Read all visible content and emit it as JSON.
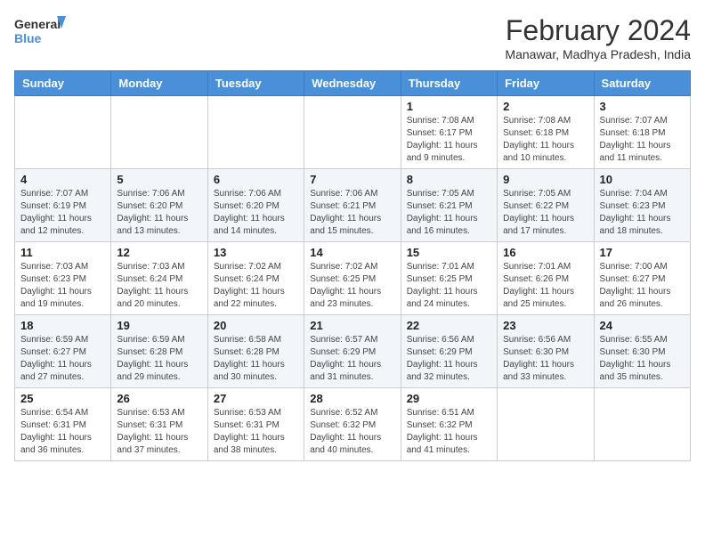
{
  "header": {
    "logo_general": "General",
    "logo_blue": "Blue",
    "month_title": "February 2024",
    "subtitle": "Manawar, Madhya Pradesh, India"
  },
  "weekdays": [
    "Sunday",
    "Monday",
    "Tuesday",
    "Wednesday",
    "Thursday",
    "Friday",
    "Saturday"
  ],
  "weeks": [
    [
      {
        "day": "",
        "info": ""
      },
      {
        "day": "",
        "info": ""
      },
      {
        "day": "",
        "info": ""
      },
      {
        "day": "",
        "info": ""
      },
      {
        "day": "1",
        "info": "Sunrise: 7:08 AM\nSunset: 6:17 PM\nDaylight: 11 hours and 9 minutes."
      },
      {
        "day": "2",
        "info": "Sunrise: 7:08 AM\nSunset: 6:18 PM\nDaylight: 11 hours and 10 minutes."
      },
      {
        "day": "3",
        "info": "Sunrise: 7:07 AM\nSunset: 6:18 PM\nDaylight: 11 hours and 11 minutes."
      }
    ],
    [
      {
        "day": "4",
        "info": "Sunrise: 7:07 AM\nSunset: 6:19 PM\nDaylight: 11 hours and 12 minutes."
      },
      {
        "day": "5",
        "info": "Sunrise: 7:06 AM\nSunset: 6:20 PM\nDaylight: 11 hours and 13 minutes."
      },
      {
        "day": "6",
        "info": "Sunrise: 7:06 AM\nSunset: 6:20 PM\nDaylight: 11 hours and 14 minutes."
      },
      {
        "day": "7",
        "info": "Sunrise: 7:06 AM\nSunset: 6:21 PM\nDaylight: 11 hours and 15 minutes."
      },
      {
        "day": "8",
        "info": "Sunrise: 7:05 AM\nSunset: 6:21 PM\nDaylight: 11 hours and 16 minutes."
      },
      {
        "day": "9",
        "info": "Sunrise: 7:05 AM\nSunset: 6:22 PM\nDaylight: 11 hours and 17 minutes."
      },
      {
        "day": "10",
        "info": "Sunrise: 7:04 AM\nSunset: 6:23 PM\nDaylight: 11 hours and 18 minutes."
      }
    ],
    [
      {
        "day": "11",
        "info": "Sunrise: 7:03 AM\nSunset: 6:23 PM\nDaylight: 11 hours and 19 minutes."
      },
      {
        "day": "12",
        "info": "Sunrise: 7:03 AM\nSunset: 6:24 PM\nDaylight: 11 hours and 20 minutes."
      },
      {
        "day": "13",
        "info": "Sunrise: 7:02 AM\nSunset: 6:24 PM\nDaylight: 11 hours and 22 minutes."
      },
      {
        "day": "14",
        "info": "Sunrise: 7:02 AM\nSunset: 6:25 PM\nDaylight: 11 hours and 23 minutes."
      },
      {
        "day": "15",
        "info": "Sunrise: 7:01 AM\nSunset: 6:25 PM\nDaylight: 11 hours and 24 minutes."
      },
      {
        "day": "16",
        "info": "Sunrise: 7:01 AM\nSunset: 6:26 PM\nDaylight: 11 hours and 25 minutes."
      },
      {
        "day": "17",
        "info": "Sunrise: 7:00 AM\nSunset: 6:27 PM\nDaylight: 11 hours and 26 minutes."
      }
    ],
    [
      {
        "day": "18",
        "info": "Sunrise: 6:59 AM\nSunset: 6:27 PM\nDaylight: 11 hours and 27 minutes."
      },
      {
        "day": "19",
        "info": "Sunrise: 6:59 AM\nSunset: 6:28 PM\nDaylight: 11 hours and 29 minutes."
      },
      {
        "day": "20",
        "info": "Sunrise: 6:58 AM\nSunset: 6:28 PM\nDaylight: 11 hours and 30 minutes."
      },
      {
        "day": "21",
        "info": "Sunrise: 6:57 AM\nSunset: 6:29 PM\nDaylight: 11 hours and 31 minutes."
      },
      {
        "day": "22",
        "info": "Sunrise: 6:56 AM\nSunset: 6:29 PM\nDaylight: 11 hours and 32 minutes."
      },
      {
        "day": "23",
        "info": "Sunrise: 6:56 AM\nSunset: 6:30 PM\nDaylight: 11 hours and 33 minutes."
      },
      {
        "day": "24",
        "info": "Sunrise: 6:55 AM\nSunset: 6:30 PM\nDaylight: 11 hours and 35 minutes."
      }
    ],
    [
      {
        "day": "25",
        "info": "Sunrise: 6:54 AM\nSunset: 6:31 PM\nDaylight: 11 hours and 36 minutes."
      },
      {
        "day": "26",
        "info": "Sunrise: 6:53 AM\nSunset: 6:31 PM\nDaylight: 11 hours and 37 minutes."
      },
      {
        "day": "27",
        "info": "Sunrise: 6:53 AM\nSunset: 6:31 PM\nDaylight: 11 hours and 38 minutes."
      },
      {
        "day": "28",
        "info": "Sunrise: 6:52 AM\nSunset: 6:32 PM\nDaylight: 11 hours and 40 minutes."
      },
      {
        "day": "29",
        "info": "Sunrise: 6:51 AM\nSunset: 6:32 PM\nDaylight: 11 hours and 41 minutes."
      },
      {
        "day": "",
        "info": ""
      },
      {
        "day": "",
        "info": ""
      }
    ]
  ]
}
